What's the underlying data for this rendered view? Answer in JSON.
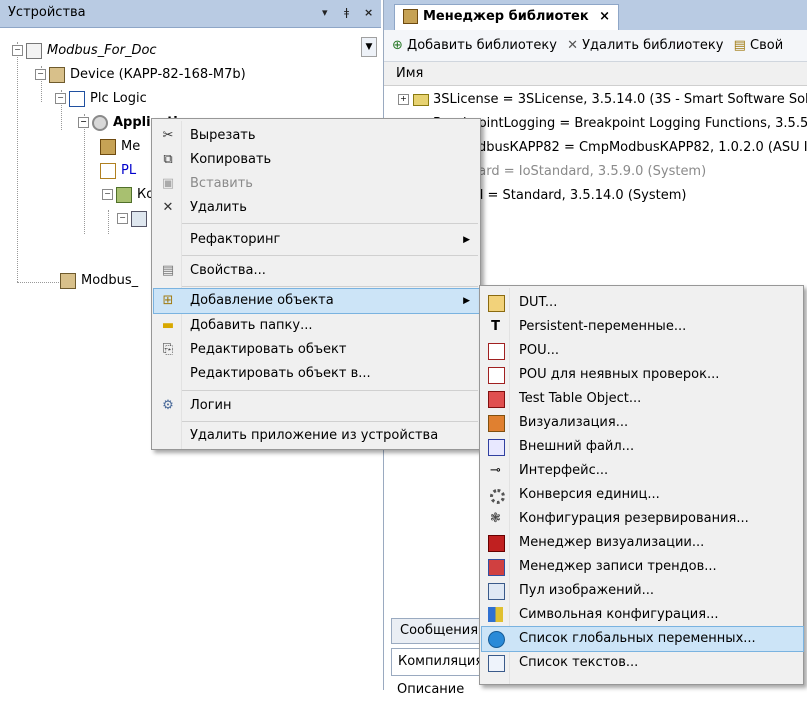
{
  "devices_panel": {
    "title": "Устройства",
    "header_controls": [
      "▾",
      "ǂ",
      "×"
    ],
    "tree": {
      "project": "Modbus_For_Doc",
      "device": "Device (КАРР-82-168-M7b)",
      "plc_logic": "Plc Logic",
      "application": "Application",
      "child_me": "Me",
      "child_pl": "PL",
      "child_ko": "Ко",
      "modbus": "Modbus_"
    }
  },
  "library_manager": {
    "tab_title": "Менеджер библиотек",
    "tab_close": "×",
    "toolbar": {
      "add_library": "Добавить библиотеку",
      "remove_library": "Удалить библиотеку",
      "properties": "Свой"
    },
    "column_name": "Имя",
    "rows": [
      {
        "text": "3SLicense = 3SLicense, 3.5.14.0 (3S - Smart Software Solu",
        "gray": false
      },
      {
        "text": "BreakpointLogging = Breakpoint Logging Functions, 3.5.5.0",
        "gray": false
      },
      {
        "text": "odbusКАРР82 = CmpModbusКАРР82, 1.0.2.0 (ASU I",
        "gray": false
      },
      {
        "text": "dard = IoStandard, 3.5.9.0 (System)",
        "gray": true
      },
      {
        "text": "rd = Standard, 3.5.14.0 (System)",
        "gray": false
      }
    ],
    "messages_tab": "Сообщения -",
    "compilation": "Компиляция",
    "description": "Описание"
  },
  "context_menu": {
    "cut": "Вырезать",
    "copy": "Копировать",
    "paste": "Вставить",
    "delete": "Удалить",
    "refactoring": "Рефакторинг",
    "properties": "Свойства...",
    "add_object": "Добавление объекта",
    "add_folder": "Добавить папку...",
    "edit_object": "Редактировать объект",
    "edit_object_in": "Редактировать объект в...",
    "login": "Логин",
    "remove_app": "Удалить приложение из устройства"
  },
  "submenu": {
    "items": [
      "DUT...",
      "Persistent-переменные...",
      "POU...",
      "POU для неявных проверок...",
      "Test Table Object...",
      "Визуализация...",
      "Внешний файл...",
      "Интерфейс...",
      "Конверсия единиц...",
      "Конфигурация резервирования...",
      "Менеджер визуализации...",
      "Менеджер записи трендов...",
      "Пул изображений...",
      "Символьная конфигурация...",
      "Список глобальных переменных...",
      "Список текстов..."
    ],
    "active_index": 14
  }
}
